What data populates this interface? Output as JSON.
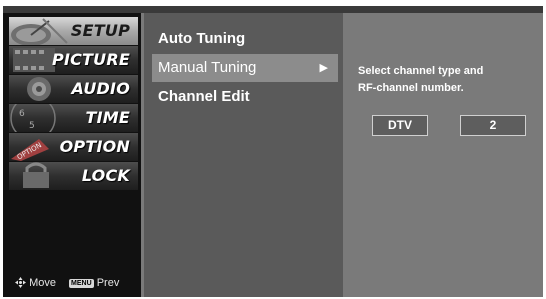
{
  "main_menu": {
    "items": [
      {
        "label": "SETUP",
        "icon": "satellite-dish-icon",
        "active": true
      },
      {
        "label": "PICTURE",
        "icon": "film-strip-icon",
        "active": false
      },
      {
        "label": "AUDIO",
        "icon": "speaker-icon",
        "active": false
      },
      {
        "label": "TIME",
        "icon": "clock-icon",
        "active": false
      },
      {
        "label": "OPTION",
        "icon": "option-tag-icon",
        "active": false
      },
      {
        "label": "LOCK",
        "icon": "padlock-icon",
        "active": false
      }
    ]
  },
  "hint": {
    "move_label": "Move",
    "menu_key": "MENU",
    "prev_label": "Prev"
  },
  "submenu": {
    "items": [
      {
        "label": "Auto Tuning",
        "selected": false
      },
      {
        "label": "Manual Tuning",
        "selected": true,
        "arrow": "▶"
      },
      {
        "label": "Channel Edit",
        "selected": false
      }
    ]
  },
  "panel": {
    "info_line1": "Select channel type and",
    "info_line2": "RF-channel number.",
    "channel_type": "DTV",
    "rf_channel": "2"
  },
  "colors": {
    "background": "#7a7a7a",
    "left_column": "#111111",
    "submenu": "#5a5a5a",
    "selected_row": "#8c8c8c"
  }
}
